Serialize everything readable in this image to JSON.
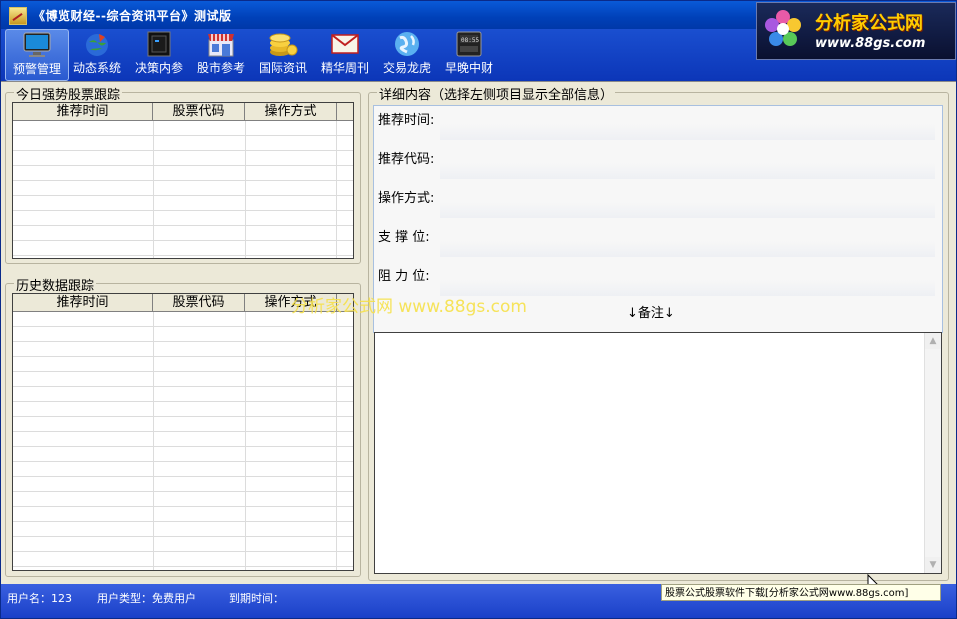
{
  "window": {
    "title": "《博览财经--综合资讯平台》测试版"
  },
  "toolbar": {
    "items": [
      {
        "label": "预警管理",
        "icon": "monitor-icon",
        "active": true
      },
      {
        "label": "动态系统",
        "icon": "globe-rocket-icon"
      },
      {
        "label": "决策内参",
        "icon": "film-panel-icon"
      },
      {
        "label": "股市参考",
        "icon": "storefront-icon"
      },
      {
        "label": "国际资讯",
        "icon": "coins-icon"
      },
      {
        "label": "精华周刊",
        "icon": "envelope-icon"
      },
      {
        "label": "交易龙虎",
        "icon": "earth-icon"
      },
      {
        "label": "早晚中财",
        "icon": "clock-device-icon"
      }
    ]
  },
  "logo": {
    "title": "分析家公式网",
    "url": "www.88gs.com"
  },
  "today_group": {
    "title": "今日强势股票跟踪",
    "columns": [
      "推荐时间",
      "股票代码",
      "操作方式"
    ]
  },
  "history_group": {
    "title": "历史数据跟踪",
    "columns": [
      "推荐时间",
      "股票代码",
      "操作方式"
    ]
  },
  "detail_group": {
    "title": "详细内容（选择左侧项目显示全部信息）",
    "fields": [
      "推荐时间:",
      "推荐代码:",
      "操作方式:",
      "支 撑 位:",
      "阻 力 位:"
    ],
    "remarks_label": "↓备注↓"
  },
  "watermark": "分析家公式网 www.88gs.com",
  "status": {
    "user": "用户名：123",
    "user_type": "用户类型：免费用户",
    "expiry": "到期时间：",
    "download_link": "股票公式股票软件下载[分析家公式网www.88gs.com]"
  },
  "colors": {
    "titlebar": "#0a5ad8",
    "toolbar": "#1a4fd0",
    "statusbar": "#3a60e0",
    "logo_text": "#ffcc00",
    "watermark": "#f6e14a"
  }
}
